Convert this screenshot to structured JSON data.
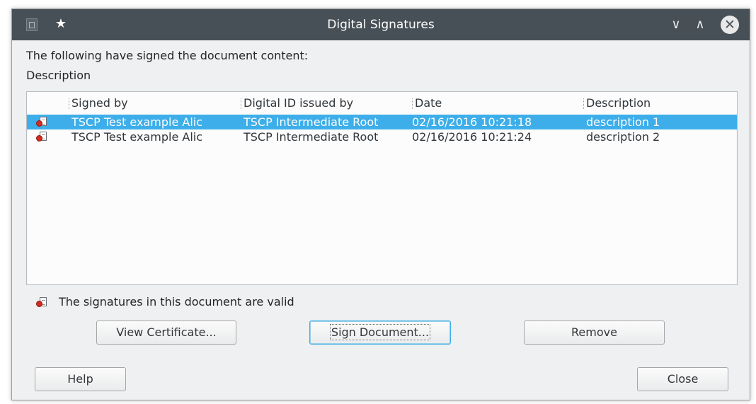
{
  "window": {
    "title": "Digital Signatures",
    "icons": {
      "app": "app-icon",
      "pin": "pin-icon",
      "minimize": "chevron-down-icon",
      "maximize": "chevron-up-icon",
      "close": "close-icon"
    }
  },
  "intro_text": "The following have signed the document content:",
  "section_label": "Description",
  "table": {
    "columns": [
      "Signed by",
      "Digital ID issued by",
      "Date",
      "Description"
    ],
    "rows": [
      {
        "signed_by": "TSCP Test example Alic",
        "issuer": "TSCP Intermediate Root",
        "date": "02/16/2016 10:21:18",
        "description": "description 1",
        "selected": true
      },
      {
        "signed_by": "TSCP Test example Alic",
        "issuer": "TSCP Intermediate Root",
        "date": "02/16/2016 10:21:24",
        "description": "description 2",
        "selected": false
      }
    ]
  },
  "status": {
    "text": "The signatures in this document are valid",
    "icon": "signature-valid-icon"
  },
  "buttons": {
    "view_certificate": "View Certificate...",
    "sign_document": "Sign Document...",
    "remove": "Remove",
    "help": "Help",
    "close": "Close"
  },
  "colors": {
    "selection": "#3daee9",
    "titlebar": "#475057",
    "seal": "#d62a1e"
  }
}
